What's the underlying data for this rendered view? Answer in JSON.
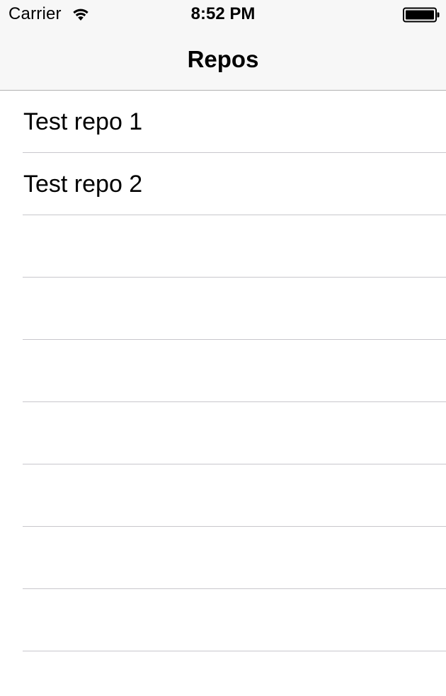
{
  "status_bar": {
    "carrier": "Carrier",
    "time": "8:52 PM",
    "wifi_icon": "wifi-icon",
    "battery_icon": "battery-icon"
  },
  "nav": {
    "title": "Repos"
  },
  "table": {
    "rows": [
      {
        "label": "Test repo 1"
      },
      {
        "label": "Test repo 2"
      },
      {
        "label": ""
      },
      {
        "label": ""
      },
      {
        "label": ""
      },
      {
        "label": ""
      },
      {
        "label": ""
      },
      {
        "label": ""
      },
      {
        "label": ""
      }
    ]
  },
  "colors": {
    "nav_background": "#f7f7f7",
    "separator": "#c8c7cc",
    "background": "#ffffff",
    "text": "#000000"
  }
}
